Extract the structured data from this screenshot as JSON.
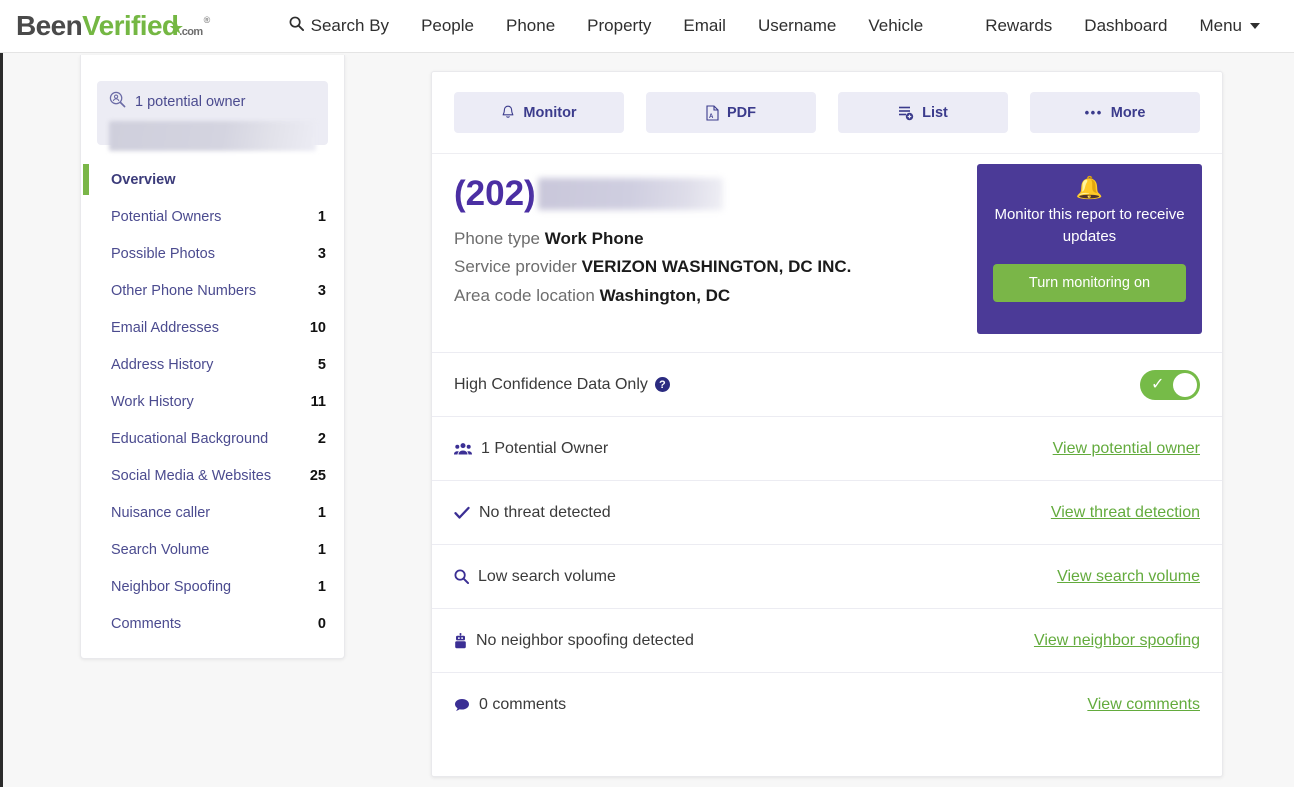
{
  "brand": {
    "logo_been": "Been",
    "logo_verified": "Verified",
    "logo_dotcom": ".com",
    "logo_reg": "®",
    "accent_green": "#7ab648",
    "accent_purple": "#4b3a97",
    "link_green": "#63ab3d"
  },
  "topnav": {
    "left_items": [
      {
        "label": "Search By",
        "icon": "search-icon"
      },
      {
        "label": "People"
      },
      {
        "label": "Phone"
      },
      {
        "label": "Property"
      },
      {
        "label": "Email"
      },
      {
        "label": "Username"
      },
      {
        "label": "Vehicle"
      }
    ],
    "right_items": [
      {
        "label": "Rewards"
      },
      {
        "label": "Dashboard"
      },
      {
        "label": "Menu",
        "icon": "chevron-down-icon"
      }
    ]
  },
  "sidebar": {
    "owner_box": {
      "icon": "search-person-icon",
      "label": "1 potential owner",
      "redacted_value": ""
    },
    "items": [
      {
        "label": "Overview",
        "count": "",
        "active": true
      },
      {
        "label": "Potential Owners",
        "count": "1"
      },
      {
        "label": "Possible Photos",
        "count": "3"
      },
      {
        "label": "Other Phone Numbers",
        "count": "3"
      },
      {
        "label": "Email Addresses",
        "count": "10"
      },
      {
        "label": "Address History",
        "count": "5"
      },
      {
        "label": "Work History",
        "count": "11"
      },
      {
        "label": "Educational Background",
        "count": "2"
      },
      {
        "label": "Social Media & Websites",
        "count": "25"
      },
      {
        "label": "Nuisance caller",
        "count": "1"
      },
      {
        "label": "Search Volume",
        "count": "1"
      },
      {
        "label": "Neighbor Spoofing",
        "count": "1"
      },
      {
        "label": "Comments",
        "count": "0"
      }
    ]
  },
  "toolbar": {
    "monitor_label": "Monitor",
    "pdf_label": "PDF",
    "list_label": "List",
    "more_label": "More",
    "more_dots": "•••"
  },
  "report": {
    "phone_prefix": "(202)",
    "phone_redacted": "",
    "phone_type_label": "Phone type",
    "phone_type_value": "Work Phone",
    "service_provider_label": "Service provider",
    "service_provider_value": "VERIZON WASHINGTON, DC INC.",
    "area_code_label": "Area code location",
    "area_code_value": "Washington, DC"
  },
  "monitor_card": {
    "bell": "🔔",
    "text": "Monitor this report to receive updates",
    "button_label": "Turn monitoring on"
  },
  "confidence": {
    "label": "High Confidence Data Only",
    "help": "?",
    "toggle_state": "on",
    "toggle_check": "✓"
  },
  "summary_rows": [
    {
      "icon": "users-icon",
      "text": "1 Potential Owner",
      "link": "View potential owner"
    },
    {
      "icon": "check-icon",
      "text": "No threat detected",
      "link": "View threat detection"
    },
    {
      "icon": "search-icon",
      "text": "Low search volume",
      "link": "View search volume"
    },
    {
      "icon": "robot-icon",
      "text": "No neighbor spoofing detected",
      "link": "View neighbor spoofing"
    },
    {
      "icon": "comment-icon",
      "text": "0 comments",
      "link": "View comments"
    }
  ]
}
